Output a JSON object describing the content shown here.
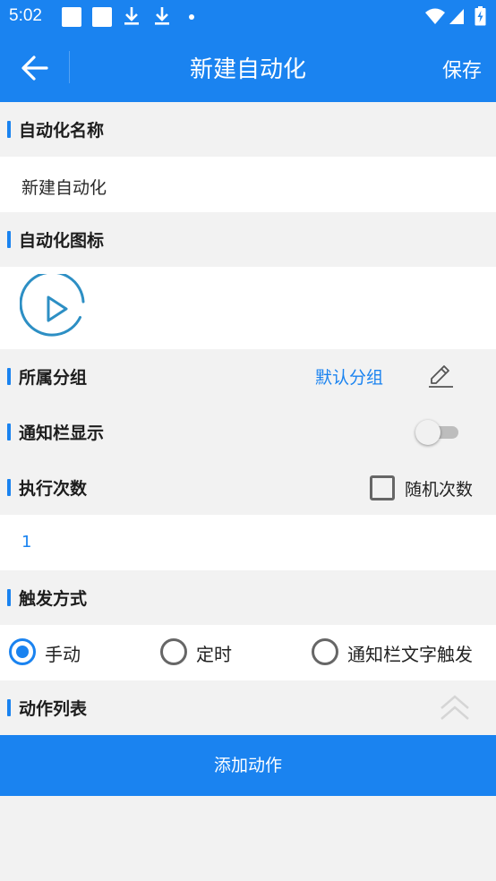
{
  "status_bar": {
    "time": "5:02"
  },
  "app_bar": {
    "title": "新建自动化",
    "save_label": "保存"
  },
  "sections": {
    "name": {
      "label": "自动化名称",
      "value": "新建自动化"
    },
    "icon": {
      "label": "自动化图标"
    },
    "group": {
      "label": "所属分组",
      "value": "默认分组"
    },
    "notification": {
      "label": "通知栏显示",
      "enabled": false
    },
    "exec_count": {
      "label": "执行次数",
      "random_label": "随机次数",
      "random_checked": false,
      "value": "1"
    },
    "trigger": {
      "label": "触发方式",
      "options": [
        "手动",
        "定时",
        "通知栏文字触发"
      ],
      "selected": "手动"
    },
    "actions": {
      "label": "动作列表"
    }
  },
  "add_action_label": "添加动作",
  "colors": {
    "accent": "#1a83f0",
    "background": "#f2f2f2",
    "icon_teal": "#2d8fc4"
  }
}
